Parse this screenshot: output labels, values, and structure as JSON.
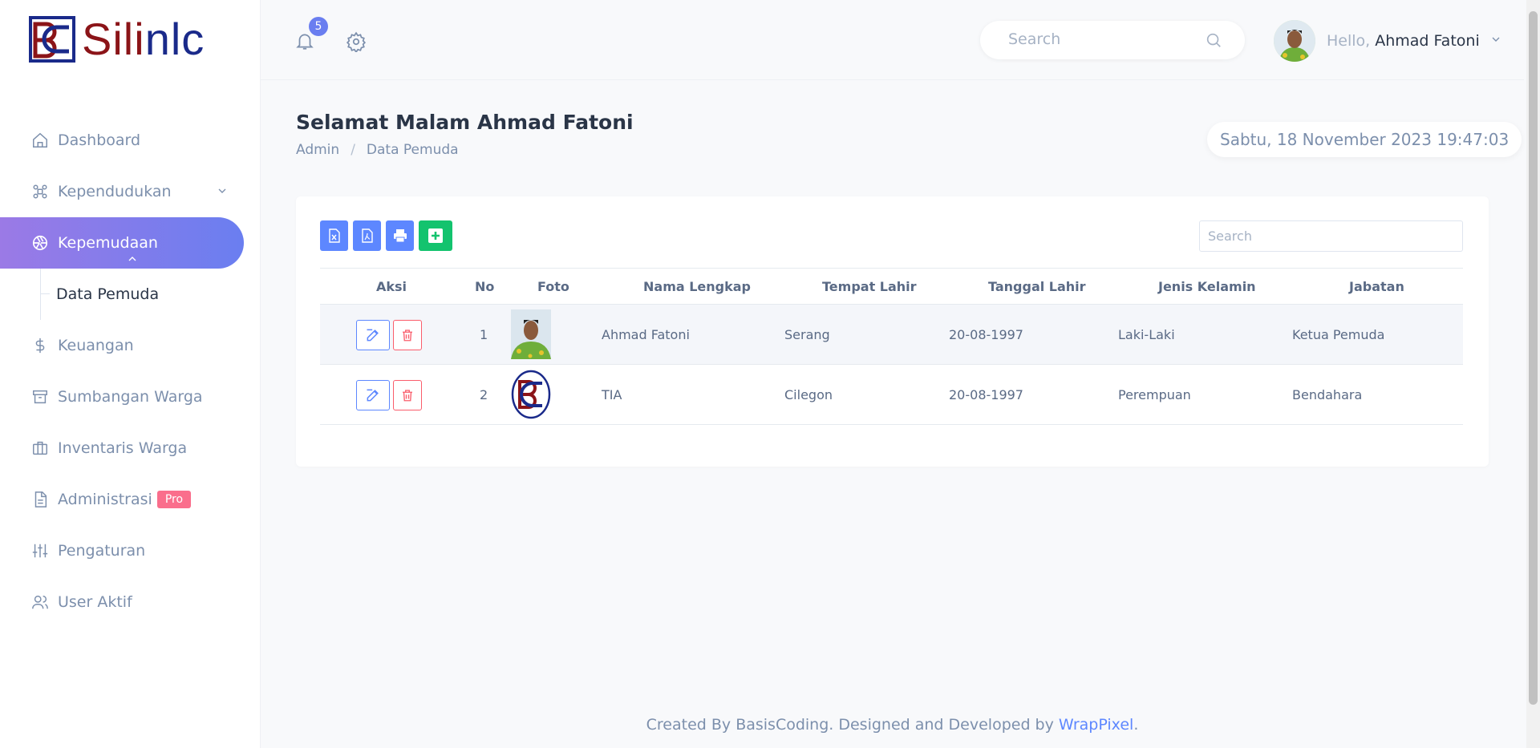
{
  "logo": {
    "text_part1": "Sili",
    "text_part2": "nlc"
  },
  "sidebar": {
    "items": [
      {
        "label": "Dashboard",
        "icon": "home-icon"
      },
      {
        "label": "Kependudukan",
        "icon": "apps-icon"
      },
      {
        "label": "Kepemudaan",
        "icon": "aperture-icon"
      },
      {
        "label": "Data Pemuda"
      },
      {
        "label": "Keuangan",
        "icon": "dollar-icon"
      },
      {
        "label": "Sumbangan Warga",
        "icon": "archive-icon"
      },
      {
        "label": "Inventaris Warga",
        "icon": "briefcase-icon"
      },
      {
        "label": "Administrasi",
        "icon": "file-icon",
        "badge": "Pro"
      },
      {
        "label": "Pengaturan",
        "icon": "sliders-icon"
      },
      {
        "label": "User Aktif",
        "icon": "users-icon"
      }
    ]
  },
  "topbar": {
    "notification_count": "5",
    "search_placeholder": "Search",
    "hello": "Hello,",
    "user_name": "Ahmad Fatoni"
  },
  "page": {
    "title": "Selamat Malam Ahmad Fatoni",
    "breadcrumb": [
      "Admin",
      "/",
      "Data Pemuda"
    ],
    "datetime": "Sabtu, 18 November 2023 19:47:03"
  },
  "table": {
    "search_placeholder": "Search",
    "columns": [
      "Aksi",
      "No",
      "Foto",
      "Nama Lengkap",
      "Tempat Lahir",
      "Tanggal Lahir",
      "Jenis Kelamin",
      "Jabatan"
    ],
    "rows": [
      {
        "no": "1",
        "nama": "Ahmad Fatoni",
        "tempat": "Serang",
        "tanggal": "20-08-1997",
        "jk": "Laki-Laki",
        "jabatan": "Ketua Pemuda"
      },
      {
        "no": "2",
        "nama": "TIA",
        "tempat": "Cilegon",
        "tanggal": "20-08-1997",
        "jk": "Perempuan",
        "jabatan": "Bendahara"
      }
    ]
  },
  "footer": {
    "text": "Created By BasisCoding. Designed and Developed by",
    "link": "WrapPixel",
    "end": "."
  },
  "colors": {
    "primary": "#5d87ff",
    "danger": "#fa5d6b",
    "success": "#13c36e",
    "brand_red": "#8b1418",
    "brand_blue": "#1a2a8a"
  }
}
